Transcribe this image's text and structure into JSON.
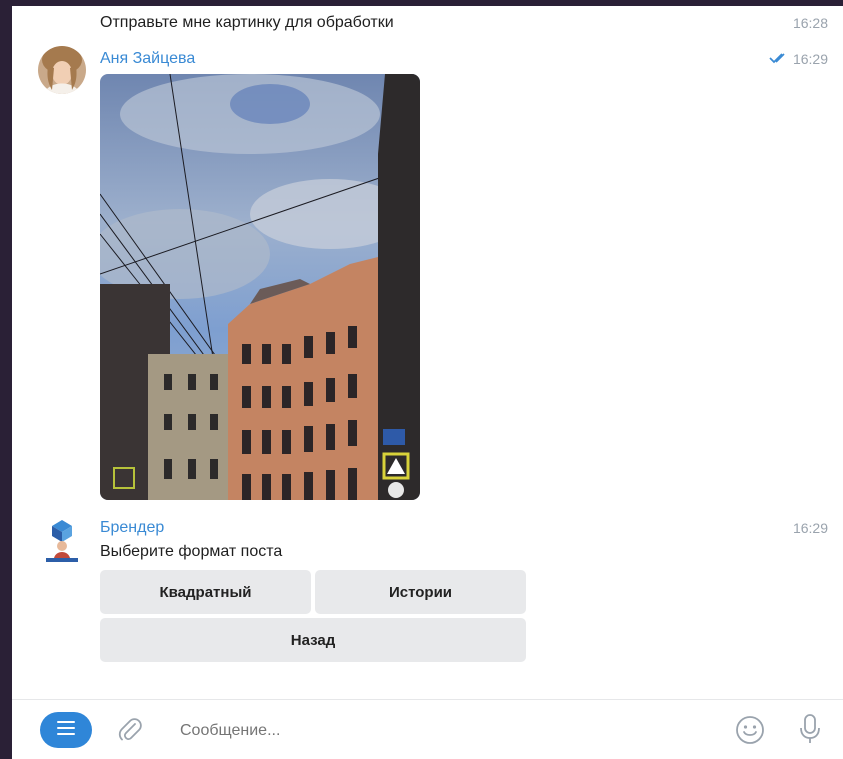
{
  "messages": [
    {
      "text": "Отправьте мне картинку для обработки",
      "time": "16:28"
    },
    {
      "sender": "Аня Зайцева",
      "time": "16:29",
      "read_icon": "double-check-icon"
    },
    {
      "sender": "Брендер",
      "text": "Выберите формат поста",
      "time": "16:29"
    }
  ],
  "keyboard": {
    "square": "Квадратный",
    "stories": "Истории",
    "back": "Назад"
  },
  "composer": {
    "placeholder": "Сообщение..."
  },
  "colors": {
    "accent": "#3a8ad4",
    "menu_button": "#2f86d8",
    "keyboard_button": "#e8e9eb",
    "time": "#9aa3ad",
    "outer": "#2a2036"
  }
}
